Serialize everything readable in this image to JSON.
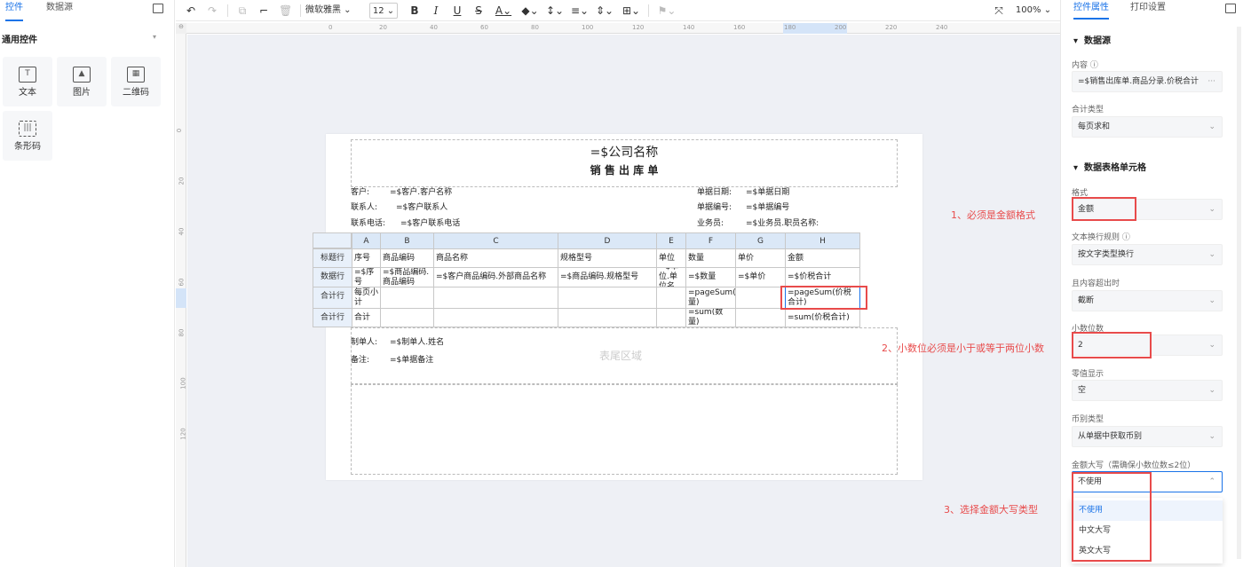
{
  "left_panel": {
    "tabs": [
      "控件",
      "数据源"
    ],
    "section_title": "通用控件",
    "widgets": [
      "文本",
      "图片",
      "二维码",
      "条形码"
    ]
  },
  "toolbar": {
    "font_name": "微软雅黑",
    "font_size": "12",
    "zoom": "100%"
  },
  "ruler": {
    "h_ticks": [
      "0",
      "20",
      "40",
      "60",
      "80",
      "100",
      "120",
      "140",
      "160",
      "180",
      "200",
      "220",
      "240"
    ],
    "v_ticks": [
      "0",
      "20",
      "40",
      "60",
      "80",
      "100",
      "120"
    ]
  },
  "report": {
    "title": "=$公司名称",
    "subtitle": "销 售 出 库 单",
    "header_fields": [
      {
        "label": "客户:",
        "value": "=$客户.客户名称"
      },
      {
        "label": "联系人:",
        "value": "=$客户联系人"
      },
      {
        "label": "联系电话:",
        "value": "=$客户联系电话"
      },
      {
        "label": "单据日期:",
        "value": "=$单据日期"
      },
      {
        "label": "单据编号:",
        "value": "=$单据编号"
      },
      {
        "label": "业务员:",
        "value": "=$业务员.职员名称:"
      }
    ],
    "columns": [
      "A",
      "B",
      "C",
      "D",
      "E",
      "F",
      "G",
      "H"
    ],
    "rows": [
      {
        "type": "标题行",
        "cells": [
          "序号",
          "商品编码",
          "商品名称",
          "规格型号",
          "单位",
          "数量",
          "单价",
          "金额"
        ]
      },
      {
        "type": "数据行",
        "cells": [
          "=$序号",
          "=$商品编码.商品编码",
          "=$客户商品编码.外部商品名称",
          "=$商品编码.规格型号",
          "=$单位.单位名",
          "=$数量",
          "=$单价",
          "=$价税合计"
        ]
      },
      {
        "type": "合计行",
        "cells": [
          "每页小计",
          "",
          "",
          "",
          "",
          "=pageSum(数量)",
          "",
          "=pageSum(价税合计)"
        ]
      },
      {
        "type": "合计行",
        "cells": [
          "合计",
          "",
          "",
          "",
          "",
          "=sum(数量)",
          "",
          "=sum(价税合计)"
        ]
      }
    ],
    "footer_fields": [
      {
        "label": "制单人:",
        "value": "=$制单人.姓名"
      },
      {
        "label": "备注:",
        "value": "=$单据备注"
      }
    ],
    "footer_area": "表尾区域"
  },
  "annotations": [
    "1、必须是金额格式",
    "2、小数位必须是小于或等于两位小数",
    "3、选择金额大写类型"
  ],
  "right_panel": {
    "tabs": [
      "控件属性",
      "打印设置"
    ],
    "section_data": "数据源",
    "content_label": "内容",
    "content_value": "=$销售出库单.商品分录.价税合计",
    "sum_type_label": "合计类型",
    "sum_type_value": "每页求和",
    "section_cell": "数据表格单元格",
    "format_label": "格式",
    "format_value": "金额",
    "wrap_label": "文本换行规则",
    "wrap_value": "按文字类型换行",
    "overflow_label": "且内容超出时",
    "overflow_value": "截断",
    "decimals_label": "小数位数",
    "decimals_value": "2",
    "zero_label": "零值显示",
    "zero_value": "空",
    "currency_label": "币别类型",
    "currency_value": "从单据中获取币别",
    "upper_label": "金额大写（需确保小数位数≤2位）",
    "upper_value": "不使用",
    "upper_options": [
      "不使用",
      "中文大写",
      "英文大写"
    ]
  },
  "colors": {
    "accent": "#1a73e8",
    "annotation": "#e84b4b",
    "header_bg": "#dbe8f7"
  }
}
